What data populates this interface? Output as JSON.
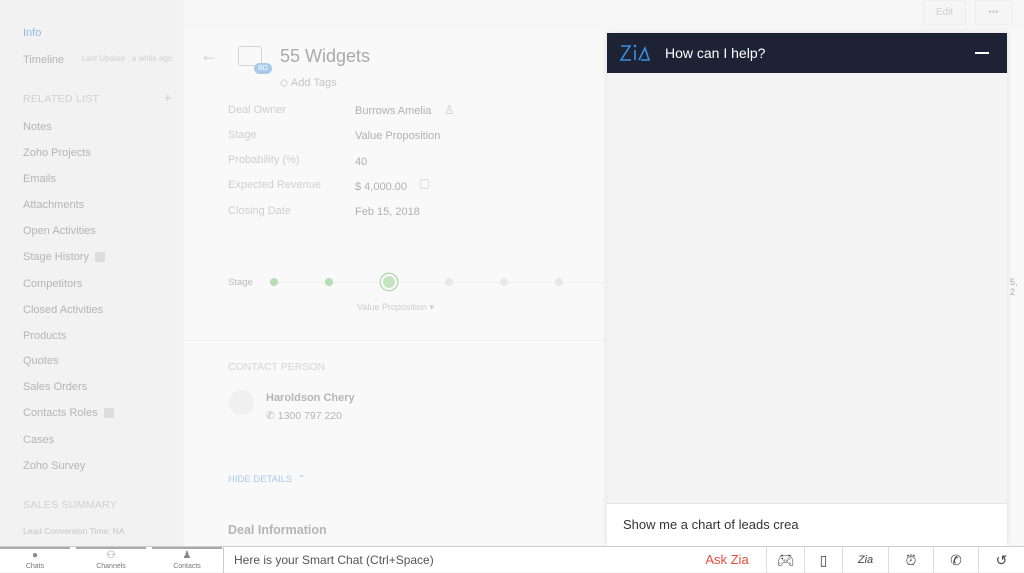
{
  "sidebar": {
    "info": "Info",
    "timeline": "Timeline",
    "last_update": "Last Update : a while ago",
    "related_list": "RELATED LIST",
    "add": "+",
    "items": [
      "Notes",
      "Zoho Projects",
      "Emails",
      "Attachments",
      "Open Activities",
      "Stage History",
      "Competitors",
      "Closed Activities",
      "Products",
      "Quotes",
      "Sales Orders",
      "Contacts Roles",
      "Cases",
      "Zoho Survey"
    ],
    "sales_summary": "SALES SUMMARY",
    "lead_conversion": "Lead Conversion Time: NA"
  },
  "toolbar": {
    "edit": "Edit",
    "more": "•••"
  },
  "record": {
    "title": "55 Widgets",
    "badge": "BD",
    "add_tags": "Add Tags",
    "fields": [
      {
        "label": "Deal Owner",
        "value": "Burrows Amelia"
      },
      {
        "label": "Stage",
        "value": "Value Proposition"
      },
      {
        "label": "Probability (%)",
        "value": "40"
      },
      {
        "label": "Expected Revenue",
        "value": "$ 4,000.00"
      },
      {
        "label": "Closing Date",
        "value": "Feb 15, 2018"
      }
    ],
    "stage_label": "Stage",
    "stage_current": "Value Proposition",
    "stage_progress": "3 of 6",
    "stage_edge": "5, 2",
    "contact_heading": "CONTACT PERSON",
    "contact_name": "Haroldson Chery",
    "contact_phone": "1300 797 220",
    "hide_details": "HIDE DETAILS",
    "deal_info": "Deal Information"
  },
  "zia": {
    "title": "How can I help?",
    "input": "Show me a chart of leads crea",
    "accent": "#1d2235"
  },
  "bottom": {
    "tabs": [
      "Chats",
      "Channels",
      "Contacts"
    ],
    "smart_chat": "Here is your Smart Chat (Ctrl+Space)",
    "ask_zia": "Ask Zia",
    "zia_icon": "Zia"
  }
}
